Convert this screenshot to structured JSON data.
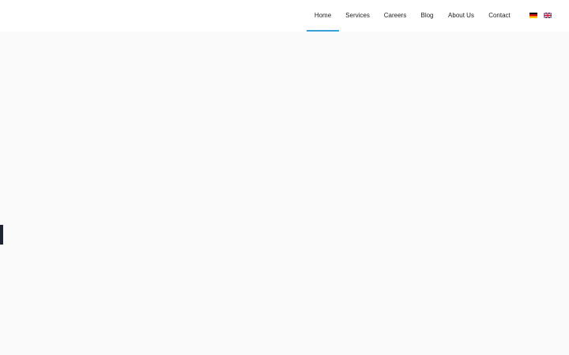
{
  "colors": {
    "accent": "#3aa0d8",
    "side_tab": "#1e2433",
    "background": "#f9f9f9",
    "header_background": "#ffffff"
  },
  "nav": {
    "items": [
      {
        "label": "Home",
        "active": true
      },
      {
        "label": "Services",
        "active": false
      },
      {
        "label": "Careers",
        "active": false
      },
      {
        "label": "Blog",
        "active": false
      },
      {
        "label": "About Us",
        "active": false
      },
      {
        "label": "Contact",
        "active": false
      }
    ]
  },
  "languages": [
    {
      "icon": "german-flag-icon"
    },
    {
      "icon": "uk-flag-icon"
    }
  ]
}
